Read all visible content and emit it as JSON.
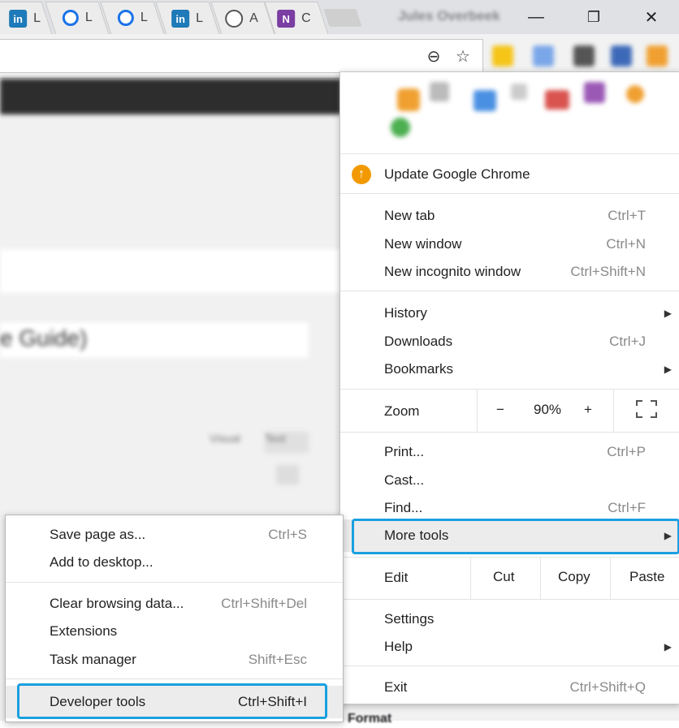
{
  "tabs": [
    {
      "icon": "linkedin-icon",
      "glyph": "in",
      "label": "L"
    },
    {
      "icon": "target-icon",
      "glyph": "",
      "label": "L"
    },
    {
      "icon": "target-icon",
      "glyph": "",
      "label": "L"
    },
    {
      "icon": "linkedin-icon",
      "glyph": "in",
      "label": "L"
    },
    {
      "icon": "head-icon",
      "glyph": "",
      "label": "A"
    },
    {
      "icon": "onenote-icon",
      "glyph": "N",
      "label": "C"
    }
  ],
  "window": {
    "profile_name": "Jules Overbeek",
    "minimize": "—",
    "restore": "❐",
    "close": "✕"
  },
  "omnibox": {
    "zoom_icon": "⊖",
    "star_icon": "☆"
  },
  "page": {
    "heading_fragment": "e Guide)",
    "visual_tab": "Visual",
    "text_tab": "Text",
    "format_label": "Format"
  },
  "menu": {
    "update": "Update Google Chrome",
    "new_tab": {
      "label": "New tab",
      "shortcut": "Ctrl+T"
    },
    "new_window": {
      "label": "New window",
      "shortcut": "Ctrl+N"
    },
    "incognito": {
      "label": "New incognito window",
      "shortcut": "Ctrl+Shift+N"
    },
    "history": {
      "label": "History"
    },
    "downloads": {
      "label": "Downloads",
      "shortcut": "Ctrl+J"
    },
    "bookmarks": {
      "label": "Bookmarks"
    },
    "zoom": {
      "label": "Zoom",
      "minus": "−",
      "value": "90%",
      "plus": "+"
    },
    "print": {
      "label": "Print...",
      "shortcut": "Ctrl+P"
    },
    "cast": {
      "label": "Cast..."
    },
    "find": {
      "label": "Find...",
      "shortcut": "Ctrl+F"
    },
    "more_tools": {
      "label": "More tools"
    },
    "edit": {
      "label": "Edit",
      "cut": "Cut",
      "copy": "Copy",
      "paste": "Paste"
    },
    "settings": {
      "label": "Settings"
    },
    "help": {
      "label": "Help"
    },
    "exit": {
      "label": "Exit",
      "shortcut": "Ctrl+Shift+Q"
    }
  },
  "submenu": {
    "save_page": {
      "label": "Save page as...",
      "shortcut": "Ctrl+S"
    },
    "add_desktop": {
      "label": "Add to desktop..."
    },
    "clear_data": {
      "label": "Clear browsing data...",
      "shortcut": "Ctrl+Shift+Del"
    },
    "extensions": {
      "label": "Extensions"
    },
    "task_manager": {
      "label": "Task manager",
      "shortcut": "Shift+Esc"
    },
    "dev_tools": {
      "label": "Developer tools",
      "shortcut": "Ctrl+Shift+I"
    }
  },
  "colors": {
    "highlight": "#1aa0e0",
    "update": "#f29900"
  }
}
